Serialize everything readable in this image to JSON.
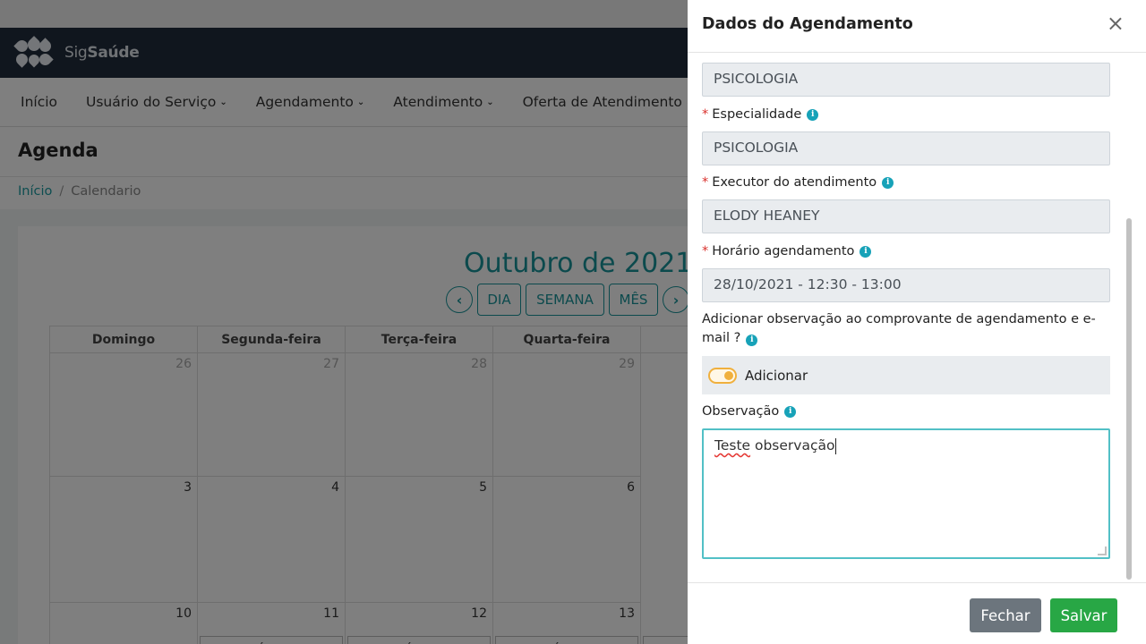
{
  "app": {
    "logo_text_light": "Sig",
    "logo_text_bold": "Saúde"
  },
  "nav": {
    "items": [
      {
        "label": "Início",
        "dropdown": false
      },
      {
        "label": "Usuário do Serviço",
        "dropdown": true
      },
      {
        "label": "Agendamento",
        "dropdown": true
      },
      {
        "label": "Atendimento",
        "dropdown": true
      },
      {
        "label": "Oferta de Atendimento",
        "dropdown": true
      }
    ]
  },
  "page": {
    "title": "Agenda",
    "breadcrumb": {
      "home": "Início",
      "separator": "/",
      "current": "Calendario"
    }
  },
  "calendar": {
    "title": "Outubro de 2021",
    "views": {
      "day": "DIA",
      "week": "SEMANA",
      "month": "MÊS"
    },
    "weekdays": [
      "Domingo",
      "Segunda-feira",
      "Terça-feira",
      "Quarta-feira",
      "Q"
    ],
    "week1": [
      "26",
      "27",
      "28",
      "29"
    ],
    "week2": [
      "3",
      "4",
      "5",
      "6"
    ],
    "week3": [
      "10",
      "11",
      "12",
      "13"
    ],
    "slot_label": "DISPONÍVEL",
    "slot_partial": "DISPO"
  },
  "modal": {
    "title": "Dados do Agendamento",
    "close_glyph": "×",
    "top_field_value": "PSICOLOGIA",
    "especialidade": {
      "label": "Especialidade",
      "value": "PSICOLOGIA"
    },
    "executor": {
      "label": "Executor do atendimento",
      "value": "ELODY HEANEY"
    },
    "horario": {
      "label": "Horário agendamento",
      "value": "28/10/2021 - 12:30 - 13:00"
    },
    "observacao_toggle": {
      "question": "Adicionar observação ao comprovante de agendamento e e-mail ?",
      "switch_label": "Adicionar",
      "enabled": true
    },
    "observacao": {
      "label": "Observação",
      "value_word1": "Teste",
      "value_rest": " observação"
    },
    "required_mark": "*",
    "info_glyph": "i",
    "buttons": {
      "close": "Fechar",
      "save": "Salvar"
    },
    "colors": {
      "close_button": "#6c757d",
      "save_button": "#28a745",
      "accent": "#18959a",
      "toggle": "#f0b03d"
    }
  }
}
